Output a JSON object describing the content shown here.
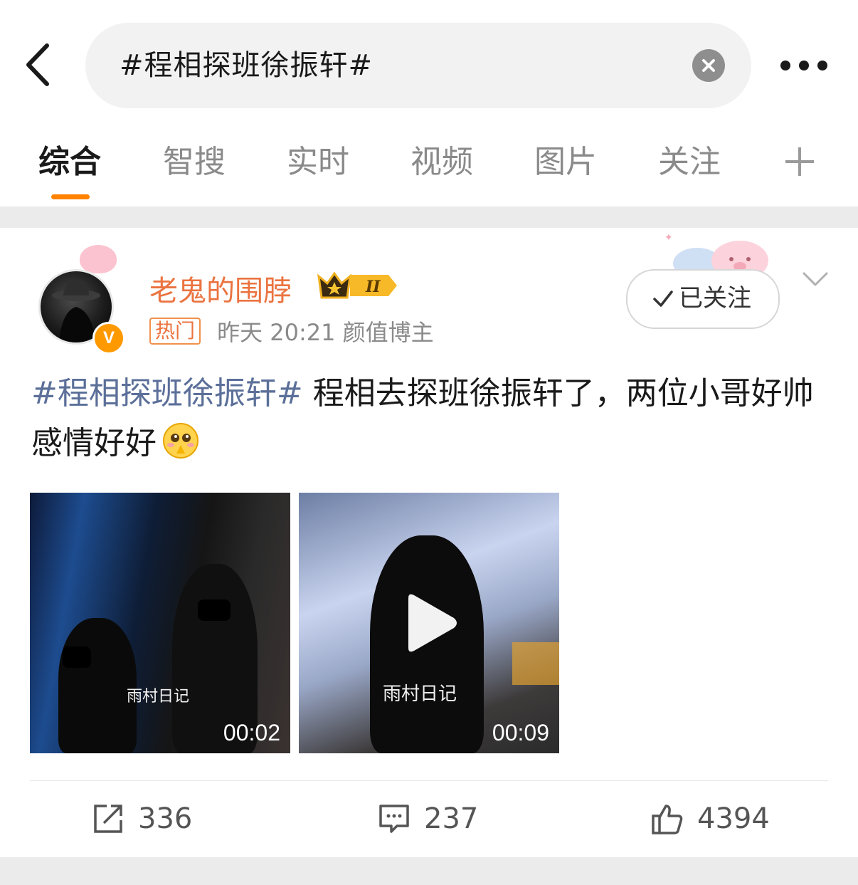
{
  "header": {
    "search_query": "#程相探班徐振轩#"
  },
  "tabs": [
    "综合",
    "智搜",
    "实时",
    "视频",
    "图片",
    "关注"
  ],
  "post": {
    "username": "老鬼的围脖",
    "badge_level": "II",
    "hot_tag": "热门",
    "meta": "昨天 20:21  颜值博主",
    "follow_label": "已关注",
    "hashtag": "#程相探班徐振轩#",
    "body": " 程相去探班徐振轩了，两位小哥好帅感情好好",
    "videos": [
      {
        "watermark": "雨村日记",
        "duration": "00:02"
      },
      {
        "watermark": "雨村日记",
        "duration": "00:09"
      }
    ],
    "actions": {
      "reposts": "336",
      "comments": "237",
      "likes": "4394"
    }
  },
  "colors": {
    "accent": "#ff8200",
    "username": "#eb7340",
    "hashtag": "#5b6f99"
  }
}
